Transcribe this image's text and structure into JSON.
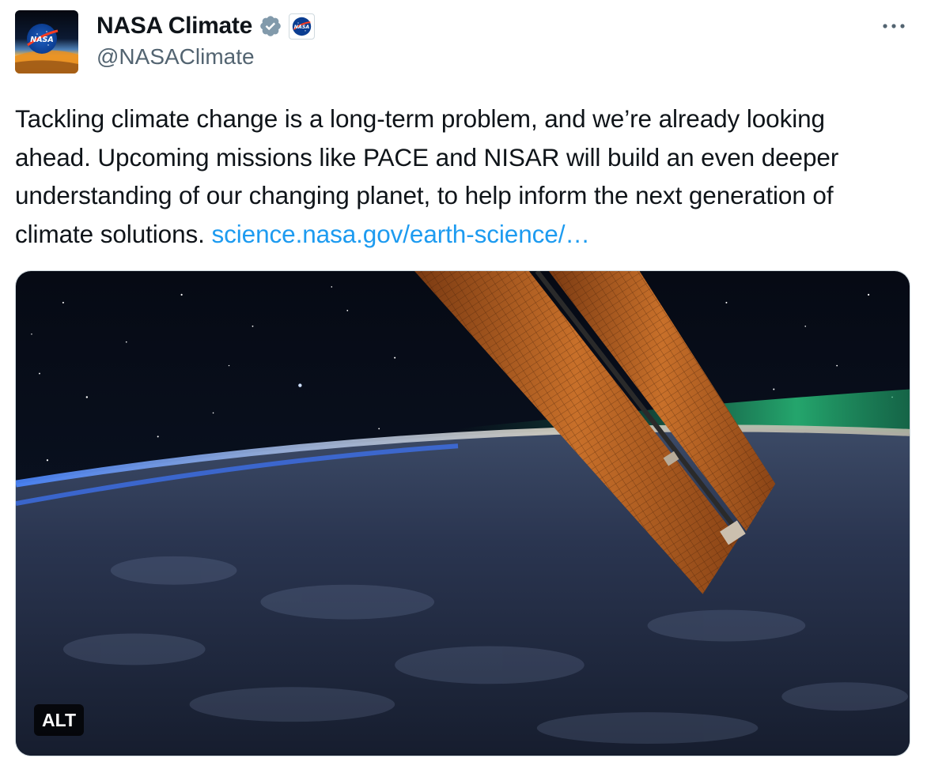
{
  "author": {
    "display_name": "NASA Climate",
    "handle": "@NASAClimate",
    "verified": true,
    "affiliate_badge": "nasa-meatball-icon",
    "avatar_logo": "NASA"
  },
  "tweet": {
    "text": "Tackling climate change is a long-term problem, and we’re already looking ahead. Upcoming missions like PACE and NISAR will build an even deeper understanding of our changing planet, to help inform the next generation of climate solutions. ",
    "link_text": "science.nasa.gov/earth-science/…"
  },
  "media": {
    "type": "photo",
    "alt_label": "ALT"
  },
  "colors": {
    "link": "#1d9bf0",
    "verified_badge": "#829aab",
    "secondary_text": "#536471"
  }
}
